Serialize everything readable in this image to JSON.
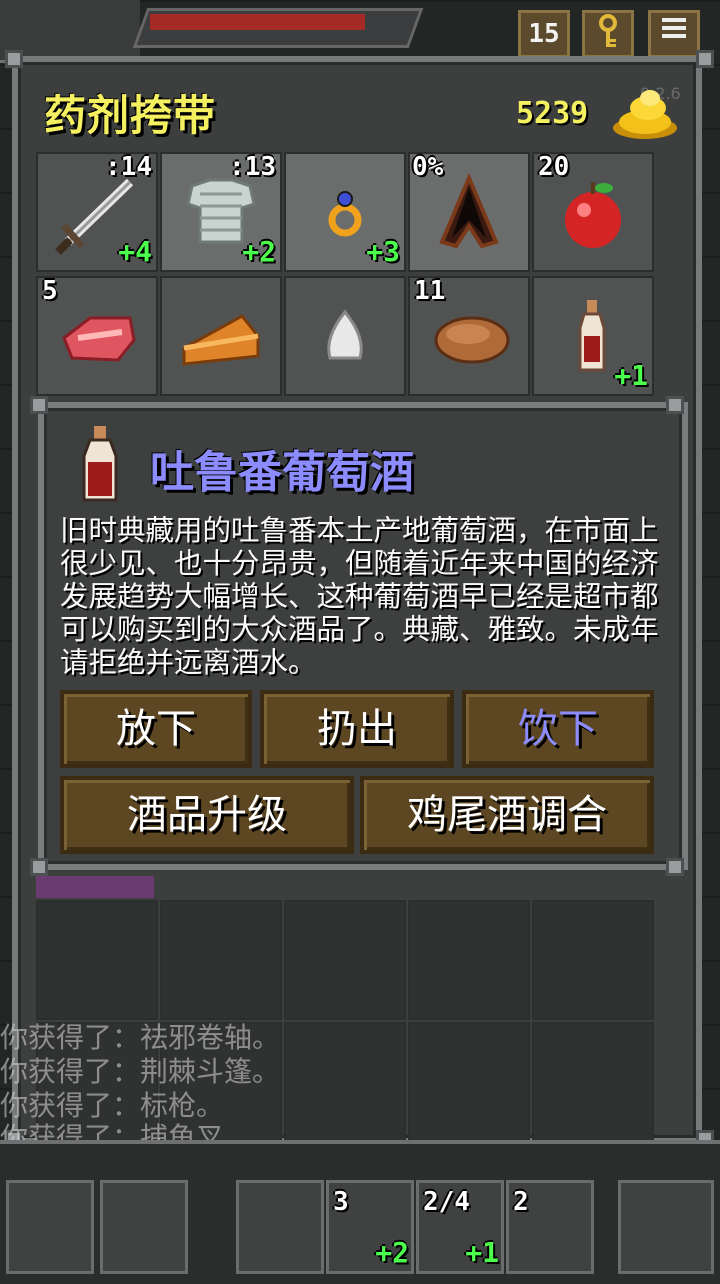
{
  "hud": {
    "depth": "15",
    "keys_icon": "key-icon",
    "menu_icon": "menu-icon"
  },
  "bag": {
    "title": "药剂挎带",
    "gold": "5239",
    "version": "0.2.6",
    "row1": [
      {
        "icon": "sword-icon",
        "count": ":14",
        "level": "+4"
      },
      {
        "icon": "chain-mail-icon",
        "count": ":13",
        "level": "+2"
      },
      {
        "icon": "ring-icon",
        "count": "",
        "level": "+3"
      },
      {
        "icon": "cloak-icon",
        "count": "0%",
        "level": ""
      },
      {
        "icon": "apple-icon",
        "count": "20",
        "level": ""
      }
    ],
    "row2": [
      {
        "icon": "meat-icon",
        "count": "5",
        "level": ""
      },
      {
        "icon": "pie-icon",
        "count": "",
        "level": ""
      },
      {
        "icon": "seed-icon",
        "count": "",
        "level": ""
      },
      {
        "icon": "bread-icon",
        "count": "11",
        "level": ""
      },
      {
        "icon": "wine-bottle-icon",
        "count": "",
        "level": "+1"
      }
    ]
  },
  "log": [
    "你获得了：祛邪卷轴。",
    "你获得了：荆棘斗篷。",
    "你获得了：标枪。",
    "你获得了：捕鱼叉。"
  ],
  "dialog": {
    "item_name": "吐鲁番葡萄酒",
    "description": "旧时典藏用的吐鲁番本土产地葡萄酒，在市面上很少见、也十分昂贵，但随着近年来中国的经济发展趋势大幅增长、这种葡萄酒早已经是超市都可以购买到的大众酒品了。典藏、雅致。未成年请拒绝并远离酒水。",
    "buttons": {
      "drop": "放下",
      "throw": "扔出",
      "drink": "饮下",
      "upgrade": "酒品升级",
      "cocktail": "鸡尾酒调合"
    }
  },
  "toolbar": {
    "quick1_count": "3",
    "quick2_count": "2/4",
    "quick3_count": "2",
    "quick_level_1": "+2",
    "quick_level_2": "+1"
  },
  "colors": {
    "title_yellow": "#f4f060",
    "item_name_blue": "#8c8cff",
    "upgrade_green": "#4cff4c",
    "button_brown": "#5c4722"
  }
}
